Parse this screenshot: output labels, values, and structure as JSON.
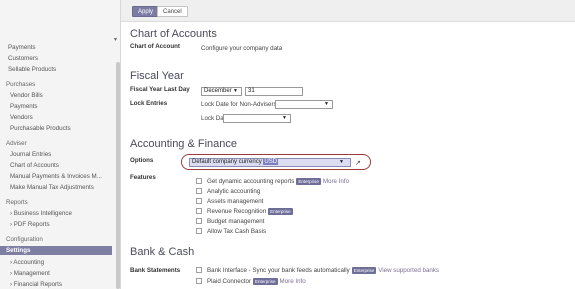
{
  "sidebar": {
    "top_items": [
      "Payments",
      "Customers",
      "Sellable Products"
    ],
    "groups": [
      {
        "label": "Purchases",
        "items": [
          "Vendor Bills",
          "Payments",
          "Vendors",
          "Purchasable Products"
        ]
      },
      {
        "label": "Adviser",
        "items": [
          "Journal Entries",
          "Chart of Accounts",
          "Manual Payments & Invoices M...",
          "Make Manual Tax Adjustments"
        ]
      },
      {
        "label": "Reports",
        "items": [
          "› Business Intelligence",
          "› PDF Reports"
        ]
      },
      {
        "label": "Configuration",
        "items": [
          "Settings",
          "› Accounting",
          "› Management",
          "› Financial Reports"
        ]
      }
    ],
    "active_item": "Settings"
  },
  "toolbar": {
    "apply_label": "Apply",
    "cancel_label": "Cancel"
  },
  "chart_of_accounts": {
    "title": "Chart of Accounts",
    "label": "Chart of Account",
    "value": "Configure your company data"
  },
  "fiscal_year": {
    "title": "Fiscal Year",
    "last_day_label": "Fiscal Year Last Day",
    "month": "December",
    "day": "31",
    "lock_entries_label": "Lock Entries",
    "lock_non_advisers_label": "Lock Date for Non-Advisers",
    "lock_date_label": "Lock Date"
  },
  "accounting_finance": {
    "title": "Accounting & Finance",
    "options_label": "Options",
    "currency_prefix": "Default company currency",
    "currency_value": "USD",
    "features_label": "Features",
    "features": [
      {
        "text": "Get dynamic accounting reports",
        "badge": "Enterprise",
        "link": "More Info"
      },
      {
        "text": "Analytic accounting",
        "badge": "",
        "link": ""
      },
      {
        "text": "Assets management",
        "badge": "",
        "link": ""
      },
      {
        "text": "Revenue Recognition",
        "badge": "Enterprise",
        "link": ""
      },
      {
        "text": "Budget management",
        "badge": "",
        "link": ""
      },
      {
        "text": "Allow Tax Cash Basis",
        "badge": "",
        "link": ""
      }
    ]
  },
  "bank_cash": {
    "title": "Bank & Cash",
    "statements_label": "Bank Statements",
    "options": [
      {
        "text": "Bank Interface - Sync your bank feeds automatically",
        "badge": "Enterprise",
        "link": "View supported banks"
      },
      {
        "text": "Plaid Connector",
        "badge": "Enterprise",
        "link": "More Info"
      }
    ]
  },
  "colors": {
    "accent": "#7c7ba4",
    "highlight_ring": "#9c3a3a",
    "badge": "#6f6e99"
  }
}
